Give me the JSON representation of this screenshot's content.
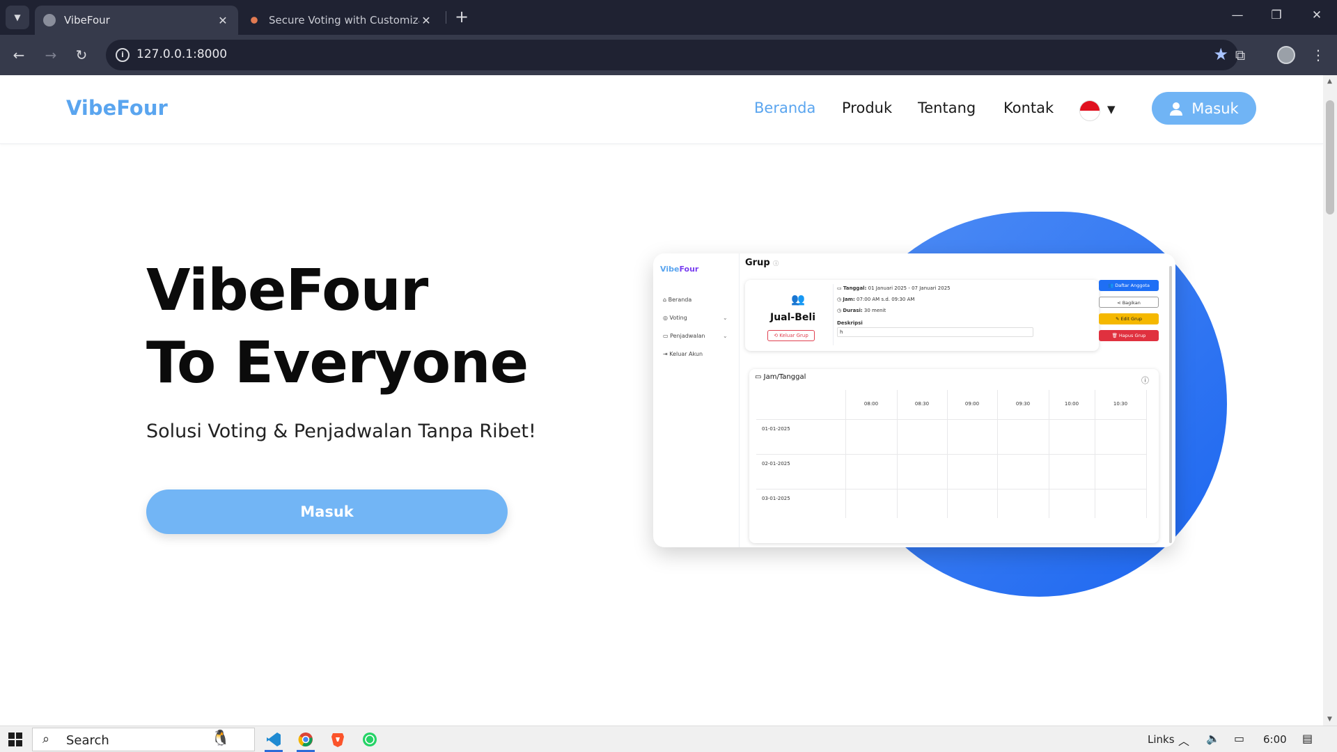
{
  "browser": {
    "tabs": [
      {
        "title": "VibeFour",
        "active": true
      },
      {
        "title": "Secure Voting with Customizabl",
        "active": false
      }
    ],
    "url": "127.0.0.1:8000",
    "controls": {
      "minimize": "—",
      "restore": "❐",
      "close": "✕"
    }
  },
  "site": {
    "logo": "VibeFour",
    "nav": [
      {
        "label": "Beranda",
        "active": true
      },
      {
        "label": "Produk",
        "active": false
      },
      {
        "label": "Tentang",
        "active": false
      },
      {
        "label": "Kontak",
        "active": false
      }
    ],
    "language": "id",
    "login_label": "Masuk"
  },
  "hero": {
    "title_line1": "VibeFour",
    "title_line2": "To Everyone",
    "subtitle": "Solusi Voting & Penjadwalan Tanpa Ribet!",
    "cta_label": "Masuk"
  },
  "mockup": {
    "logo_part1": "Vibe",
    "logo_part2": "Four",
    "sidebar": [
      {
        "label": "Beranda",
        "icon": "home-icon",
        "expandable": false
      },
      {
        "label": "Voting",
        "icon": "check-circle-icon",
        "expandable": true
      },
      {
        "label": "Penjadwalan",
        "icon": "calendar-icon",
        "expandable": true
      },
      {
        "label": "Keluar Akun",
        "icon": "logout-icon",
        "expandable": false
      }
    ],
    "page_title": "Grup",
    "group_name": "Jual-Beli",
    "leave_label": "Keluar Grup",
    "info": {
      "date_label": "Tanggal:",
      "date_value": "01 Januari 2025 - 07 Januari 2025",
      "time_label": "Jam:",
      "time_value": "07:00 AM s.d. 09:30 AM",
      "duration_label": "Durasi:",
      "duration_value": "30 menit",
      "desc_label": "Deskripsi",
      "desc_value": "h"
    },
    "actions": [
      {
        "label": "Daftar Anggota",
        "color": "#1f6ff5"
      },
      {
        "label": "Bagikan",
        "color": "#ffffff"
      },
      {
        "label": "Edit Grup",
        "color": "#f5b800"
      },
      {
        "label": "Hapus Grup",
        "color": "#e0313f"
      }
    ],
    "schedule_title": "Jam/Tanggal",
    "times": [
      "08:00",
      "08:30",
      "09:00",
      "09:30",
      "10:00",
      "10:30"
    ],
    "dates": [
      "01-01-2025",
      "02-01-2025",
      "03-01-2025"
    ]
  },
  "taskbar": {
    "search_placeholder": "Search",
    "apps": [
      "vscode",
      "chrome",
      "brave",
      "whatsapp"
    ],
    "tray_links": "Links",
    "time": "6:00"
  }
}
